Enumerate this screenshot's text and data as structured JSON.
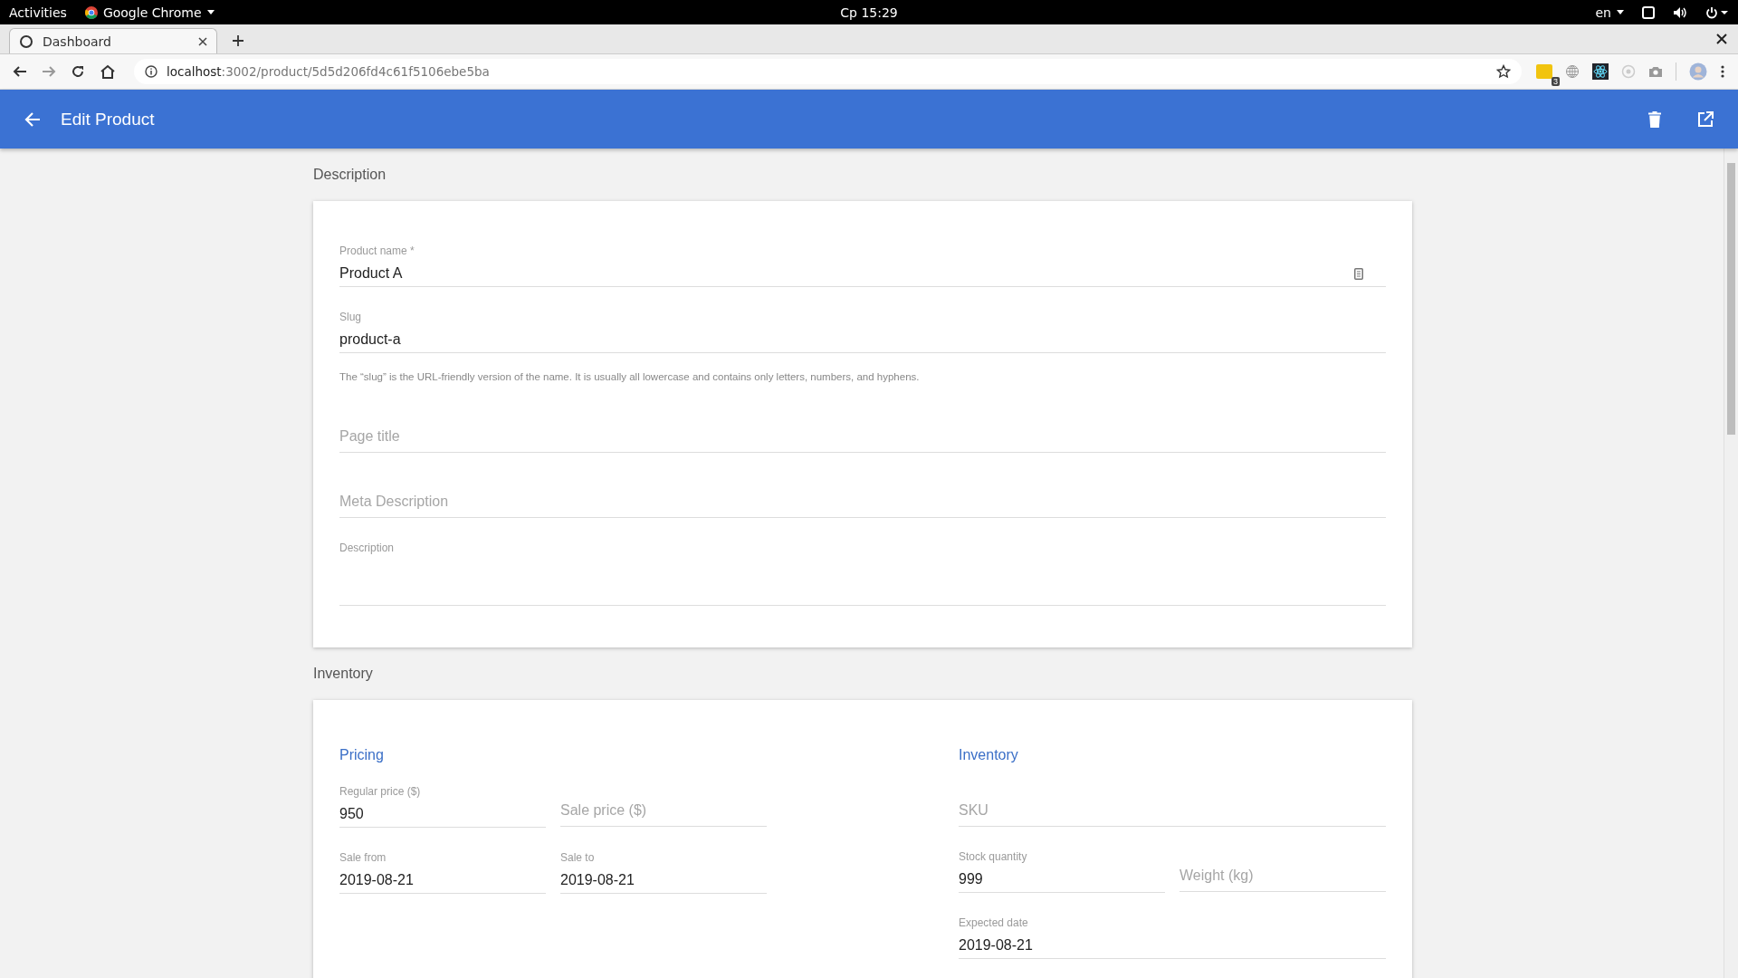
{
  "os_bar": {
    "activities": "Activities",
    "app": "Google Chrome",
    "clock": "Cp 15:29",
    "language": "en"
  },
  "browser": {
    "tabs": [
      {
        "title": "Dashboard",
        "selected": true
      }
    ],
    "url_host": "localhost",
    "url_path": ":3002/product/5d5d206fd4c61f5106ebe5ba",
    "extension_badge": "3"
  },
  "app_bar": {
    "title": "Edit Product"
  },
  "sections": [
    {
      "title": "Description",
      "kind": "fields",
      "fields": [
        {
          "kind": "text",
          "label": "Product name *",
          "value": "Product A",
          "has_icon": true
        },
        {
          "kind": "text",
          "label": "Slug",
          "value": "product-a",
          "help": "The “slug” is the URL-friendly version of the name. It is usually all lowercase and contains only letters, numbers, and hyphens."
        },
        {
          "kind": "empty",
          "placeholder": "Page title"
        },
        {
          "kind": "empty",
          "placeholder": "Meta Description"
        },
        {
          "kind": "textarea",
          "label": "Description"
        }
      ]
    },
    {
      "title": "Inventory",
      "kind": "groups",
      "groups": [
        {
          "heading": "Pricing",
          "rows": [
            [
              {
                "kind": "text",
                "label": "Regular price ($)",
                "value": "950"
              },
              {
                "kind": "empty",
                "placeholder": "Sale price ($)"
              }
            ],
            [
              {
                "kind": "text",
                "label": "Sale from",
                "value": "2019-08-21"
              },
              {
                "kind": "text",
                "label": "Sale to",
                "value": "2019-08-21"
              }
            ]
          ]
        },
        {
          "heading": "Inventory",
          "rows": [
            [
              {
                "kind": "empty",
                "placeholder": "SKU"
              }
            ],
            [
              {
                "kind": "text",
                "label": "Stock quantity",
                "value": "999"
              },
              {
                "kind": "empty",
                "placeholder": "Weight (kg)"
              }
            ],
            [
              {
                "kind": "text",
                "label": "Expected date",
                "value": "2019-08-21"
              }
            ]
          ]
        }
      ]
    }
  ]
}
